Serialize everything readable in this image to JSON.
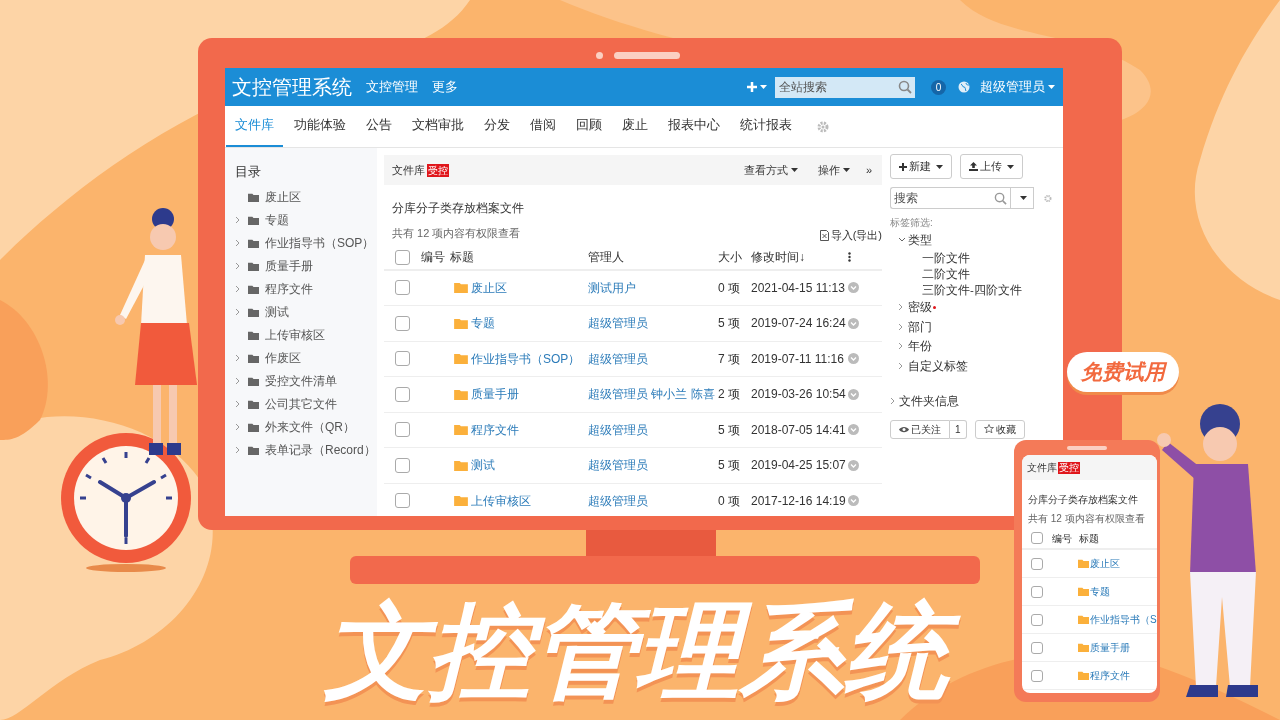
{
  "app": {
    "logo": "文控管理系统",
    "top_nav": [
      "文控管理",
      "更多"
    ],
    "search": {
      "placeholder": "全站搜索"
    },
    "notification_count": "0",
    "user": "超级管理员"
  },
  "tabs": [
    {
      "label": "文件库",
      "selected": true
    },
    {
      "label": "功能体验",
      "selected": false
    },
    {
      "label": "公告",
      "selected": false
    },
    {
      "label": "文档审批",
      "selected": false
    },
    {
      "label": "分发",
      "selected": false
    },
    {
      "label": "借阅",
      "selected": false
    },
    {
      "label": "回顾",
      "selected": false
    },
    {
      "label": "废止",
      "selected": false
    },
    {
      "label": "报表中心",
      "selected": false
    },
    {
      "label": "统计报表",
      "selected": false
    }
  ],
  "sidebar": {
    "title": "目录",
    "items": [
      {
        "label": "废止区",
        "expandable": false
      },
      {
        "label": "专题",
        "expandable": true
      },
      {
        "label": "作业指导书（SOP）",
        "expandable": true
      },
      {
        "label": "质量手册",
        "expandable": true
      },
      {
        "label": "程序文件",
        "expandable": true
      },
      {
        "label": "测试",
        "expandable": true
      },
      {
        "label": "上传审核区",
        "expandable": false
      },
      {
        "label": "作废区",
        "expandable": true
      },
      {
        "label": "受控文件清单",
        "expandable": true
      },
      {
        "label": "公司其它文件",
        "expandable": true
      },
      {
        "label": "外来文件（QR）",
        "expandable": true
      },
      {
        "label": "表单记录（Record）",
        "expandable": true
      }
    ]
  },
  "main": {
    "breadcrumb": "文件库",
    "tag": "受控",
    "view_menu": "查看方式",
    "actions_menu": "操作",
    "more": "»",
    "heading": "分库分子类存放档案文件",
    "count": "共有 12 项内容有权限查看",
    "export": "导入(导出)",
    "select_all": {
      "checked": false
    },
    "columns": [
      "编号",
      "标题",
      "管理人",
      "大小",
      "修改时间↓"
    ],
    "rows": [
      {
        "checked": false,
        "title": "废止区",
        "manager": "测试用户",
        "size": "0 项",
        "modified": "2021-04-15 11:13"
      },
      {
        "checked": false,
        "title": "专题",
        "manager": "超级管理员",
        "size": "5 项",
        "modified": "2019-07-24 16:24"
      },
      {
        "checked": false,
        "title": "作业指导书（SOP）",
        "manager": "超级管理员",
        "size": "7 项",
        "modified": "2019-07-11 11:16"
      },
      {
        "checked": false,
        "title": "质量手册",
        "manager": "超级管理员 钟小兰 陈喜",
        "size": "2 项",
        "modified": "2019-03-26 10:54"
      },
      {
        "checked": false,
        "title": "程序文件",
        "manager": "超级管理员",
        "size": "5 项",
        "modified": "2018-07-05 14:41"
      },
      {
        "checked": false,
        "title": "测试",
        "manager": "超级管理员",
        "size": "5 项",
        "modified": "2019-04-25 15:07"
      },
      {
        "checked": false,
        "title": "上传审核区",
        "manager": "超级管理员",
        "size": "0 项",
        "modified": "2017-12-16 14:19"
      }
    ]
  },
  "right_panel": {
    "buttons": [
      "新建",
      "上传"
    ],
    "search": {
      "placeholder": "搜索"
    },
    "filter_label": "标签筛选:",
    "tags": [
      {
        "label": "类型",
        "expanded": true,
        "required": false,
        "children": [
          {
            "label": "一阶文件"
          },
          {
            "label": "二阶文件"
          },
          {
            "label": "三阶文件-四阶文件"
          }
        ]
      },
      {
        "label": "密级",
        "expanded": false,
        "required": true
      },
      {
        "label": "部门",
        "expanded": false,
        "required": false
      },
      {
        "label": "年份",
        "expanded": false,
        "required": false
      },
      {
        "label": "自定义标签",
        "expanded": false,
        "required": false
      }
    ],
    "folder_info": "文件夹信息",
    "follow": "已关注",
    "follow_count": "1",
    "favorite": "收藏"
  },
  "phone": {
    "breadcrumb": "文件库",
    "tag": "受控",
    "heading": "分库分子类存放档案文件",
    "count": "共有 12 项内容有权限查看",
    "select_all": {
      "checked": false
    },
    "columns": [
      "编号",
      "标题"
    ],
    "rows": [
      {
        "checked": false,
        "title": "废止区"
      },
      {
        "checked": false,
        "title": "专题"
      },
      {
        "checked": false,
        "title": "作业指导书（S"
      },
      {
        "checked": false,
        "title": "质量手册"
      },
      {
        "checked": false,
        "title": "程序文件"
      }
    ]
  },
  "promo": {
    "badge": "免费试用",
    "title": "文控管理系统"
  }
}
